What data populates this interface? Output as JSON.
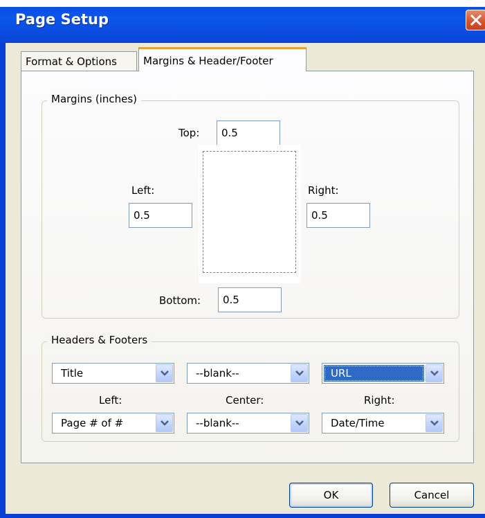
{
  "window": {
    "title": "Page Setup"
  },
  "tabs": [
    {
      "label": "Format & Options",
      "active": false
    },
    {
      "label": "Margins & Header/Footer",
      "active": true
    }
  ],
  "margins": {
    "legend": "Margins (inches)",
    "top": {
      "label": "Top:",
      "value": "0.5"
    },
    "left": {
      "label": "Left:",
      "value": "0.5"
    },
    "right": {
      "label": "Right:",
      "value": "0.5"
    },
    "bottom": {
      "label": "Bottom:",
      "value": "0.5"
    }
  },
  "headers_footers": {
    "legend": "Headers & Footers",
    "column_labels": {
      "left": "Left:",
      "center": "Center:",
      "right": "Right:"
    },
    "header": {
      "left": "Title",
      "center": "--blank--",
      "right": "URL"
    },
    "footer": {
      "left": "Page # of #",
      "center": "--blank--",
      "right": "Date/Time"
    }
  },
  "buttons": {
    "ok": "OK",
    "cancel": "Cancel"
  },
  "colors": {
    "titlebar": "#0a47e0",
    "selection": "#316ac5",
    "dialog_bg": "#ece9d8"
  },
  "icons": {
    "close": "close-icon",
    "dropdown": "chevron-down-icon"
  }
}
